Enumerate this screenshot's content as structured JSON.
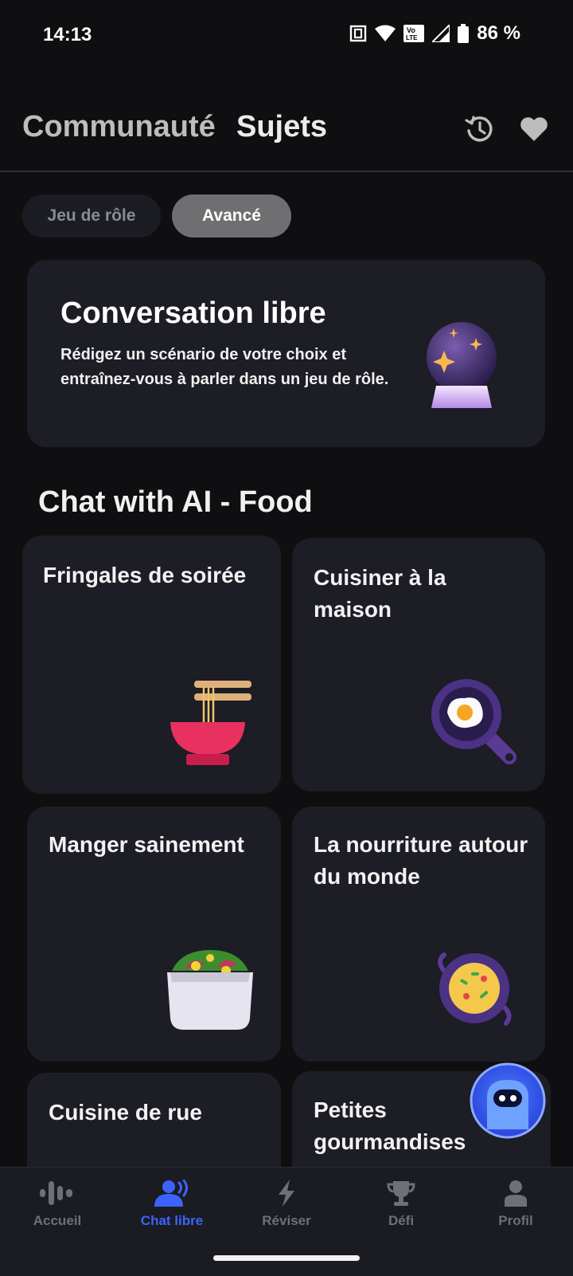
{
  "status_bar": {
    "time": "14:13",
    "battery": "86 %",
    "icons": [
      "nfc-icon",
      "wifi-icon",
      "volte-icon",
      "signal-icon",
      "battery-icon"
    ]
  },
  "header": {
    "tabs": [
      {
        "label": "Communauté",
        "active": false
      },
      {
        "label": "Sujets",
        "active": true
      }
    ],
    "actions": [
      "history-icon",
      "heart-icon"
    ]
  },
  "filter_chips": [
    {
      "label": "Jeu de rôle",
      "selected": false
    },
    {
      "label": "Avancé",
      "selected": true
    }
  ],
  "hero_card": {
    "title": "Conversation libre",
    "description": "Rédigez un scénario de votre choix et entraînez-vous à parler dans un jeu de rôle.",
    "icon": "crystal-ball-icon"
  },
  "section": {
    "title": "Chat with AI - Food",
    "topics": [
      {
        "title": "Fringales de soirée",
        "icon": "noodle-bowl-icon"
      },
      {
        "title": "Cuisiner à la maison",
        "icon": "frying-pan-egg-icon"
      },
      {
        "title": "Manger sainement",
        "icon": "salad-bowl-icon"
      },
      {
        "title": "La nourriture autour du monde",
        "icon": "paella-pan-icon"
      },
      {
        "title": "Cuisine de rue",
        "icon": ""
      },
      {
        "title": "Petites gourmandises",
        "icon": ""
      }
    ]
  },
  "floating_button": {
    "icon": "ai-assistant-icon"
  },
  "bottom_nav": {
    "items": [
      {
        "label": "Accueil",
        "icon": "waveform-icon",
        "active": false
      },
      {
        "label": "Chat libre",
        "icon": "speaking-person-icon",
        "active": true
      },
      {
        "label": "Réviser",
        "icon": "lightning-icon",
        "active": false
      },
      {
        "label": "Défi",
        "icon": "trophy-icon",
        "active": false
      },
      {
        "label": "Profil",
        "icon": "person-icon",
        "active": false
      }
    ]
  },
  "colors": {
    "background": "#0f0f11",
    "card": "#1c1d25",
    "accent": "#3d63ff",
    "chip_selected": "#6f6f72"
  }
}
